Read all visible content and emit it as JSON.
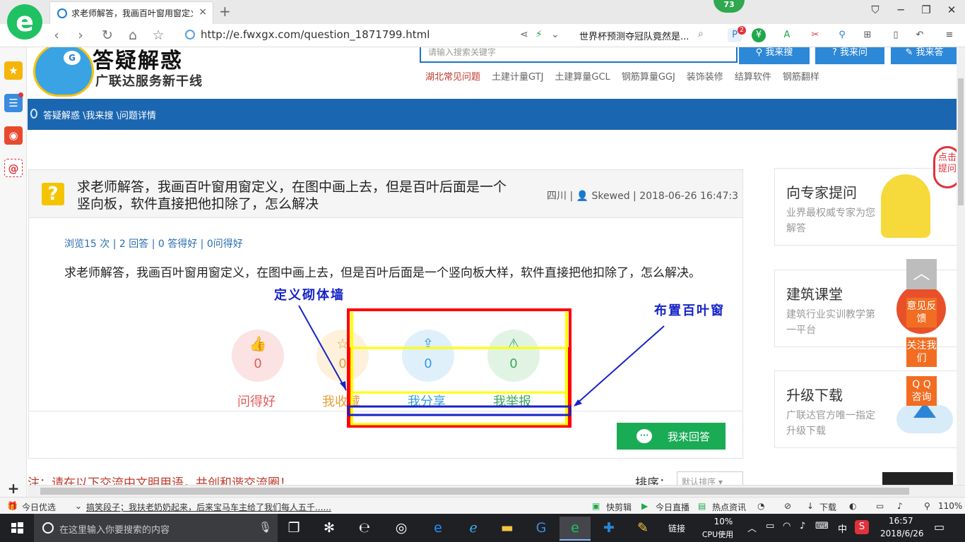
{
  "browser": {
    "tab_title": "求老师解答，我画百叶窗用窗定义，在图中画上去，但是百叶后面是一个竖向板，软件直接把他扣除了，怎么解决",
    "tab_close": "×",
    "new_tab": "+",
    "badge": "73",
    "url": "http://e.fwxgx.com/question_1871799.html",
    "news_ticker": "世界杯预测夺冠队竟然是...",
    "window_buttons": [
      "⛉",
      "─",
      "❐",
      "✕"
    ],
    "toolbar_badge": "2"
  },
  "site_header": {
    "logo_title": "答疑解惑",
    "logo_subtitle": "广联达服务新干线",
    "logo_mark": "G",
    "search_placeholder": "请输入搜索关键字",
    "search_buttons": [
      "我来搜",
      "我来问",
      "我来答"
    ],
    "hot_links": [
      "湖北常见问题",
      "土建计量GTJ",
      "土建算量GCL",
      "钢筋算量GGJ",
      "装饰装修",
      "结算软件",
      "钢筋翻样"
    ]
  },
  "breadcrumb": "答疑解惑 \\我来搜 \\问题详情",
  "question": {
    "icon": "?",
    "title": "求老师解答，我画百叶窗用窗定义，在图中画上去，但是百叶后面是一个竖向板，软件直接把他扣除了，怎么解决",
    "region": "四川",
    "author": "Skewed",
    "datetime": "2018-06-26 16:47:3",
    "stats": "浏览15 次 | 2 回答 | 0 答得好 | 0问得好",
    "body": "求老师解答，我画百叶窗用窗定义，在图中画上去，但是百叶后面是一个竖向板大样，软件直接把他扣除了，怎么解决。",
    "actions": [
      {
        "label": "问得好",
        "count": "0",
        "icon": "thumbs-up-icon",
        "color": "#e35b5b",
        "bg": "#fbe3e3"
      },
      {
        "label": "我收藏",
        "count": "0",
        "icon": "star-icon",
        "color": "#e4a03a",
        "bg": "#fdf1dc"
      },
      {
        "label": "我分享",
        "count": "0",
        "icon": "share-icon",
        "color": "#3a9ae0",
        "bg": "#dff0fb"
      },
      {
        "label": "我举报",
        "count": "0",
        "icon": "warning-icon",
        "color": "#3aa85a",
        "bg": "#e1f4e4"
      }
    ],
    "answer_button": "我来回答",
    "notice": "注：请在以下交流中文明用语，共创和谐交流圈！",
    "sort_label": "排序：",
    "sort_value": "默认排序"
  },
  "right_panels": [
    {
      "title": "向专家提问",
      "desc": "业界最权威专家为您解答"
    },
    {
      "title": "建筑课堂",
      "desc": "建筑行业实训教学第一平台"
    },
    {
      "title": "升级下载",
      "desc": "广联达官方唯一指定升级下载"
    }
  ],
  "mascot_bubble": "点击提问",
  "floating_buttons": [
    "意见反馈",
    "关注我们",
    "Q Q 咨询"
  ],
  "annotations": {
    "label_left": "定义砌体墙",
    "label_right": "布置百叶窗"
  },
  "status_bar": {
    "today": "今日优选",
    "headline": "搞笑段子；我扶老奶奶起来，后来宝马车主给了我们每人五千......",
    "items": [
      "快剪辑",
      "今日直播",
      "热点资讯",
      "下载"
    ],
    "zoom": "110%"
  },
  "taskbar": {
    "search_placeholder": "在这里输入你要搜索的内容",
    "link_label": "链接",
    "cpu_percent": "10%",
    "cpu_label": "CPU使用",
    "ime": "中",
    "time": "16:57",
    "date": "2018/6/26"
  }
}
